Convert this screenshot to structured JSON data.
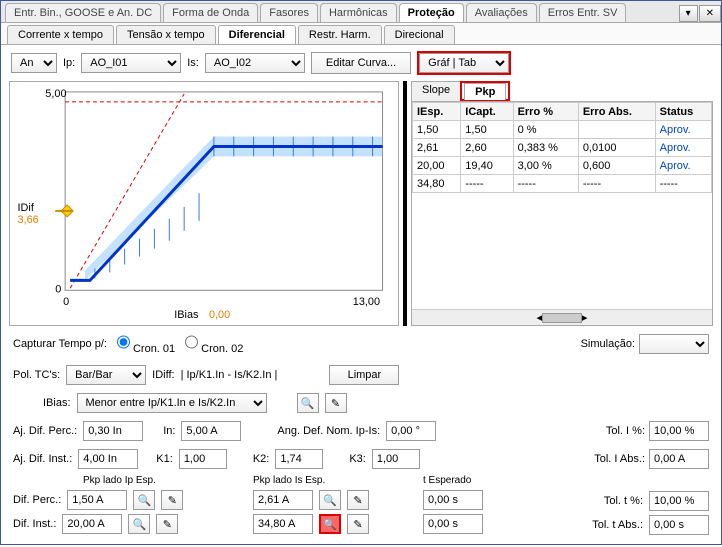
{
  "top_tabs": [
    "Entr. Bin., GOOSE e An. DC",
    "Forma de Onda",
    "Fasores",
    "Harmônicas",
    "Proteção",
    "Avaliações",
    "Erros Entr. SV"
  ],
  "top_active": 4,
  "sub_tabs": [
    "Corrente x tempo",
    "Tensão x tempo",
    "Diferencial",
    "Restr. Harm.",
    "Direcional"
  ],
  "sub_active": 2,
  "toolbar": {
    "an_label": "An",
    "an_value": "",
    "ip_label": "Ip:",
    "ip_value": "AO_I01",
    "is_label": "Is:",
    "is_value": "AO_I02",
    "edit_curve": "Editar Curva...",
    "graf_tab": "Gráf | Tab"
  },
  "chart_data": {
    "type": "line",
    "xlabel": "IBias",
    "xvalue": "0,00",
    "ylabel": "IDif",
    "yvalue": "3,66",
    "xlim": [
      0,
      13
    ],
    "ylim": [
      0,
      5
    ],
    "xticks": [
      0,
      13.0
    ],
    "yticks": [
      0,
      5.0
    ],
    "series": [
      {
        "name": "dashed-red",
        "values": [
          [
            0,
            0
          ],
          [
            4.6,
            5.0
          ]
        ],
        "style": "red-dashed"
      },
      {
        "name": "ref-line",
        "values": [
          [
            0,
            5.0
          ],
          [
            13,
            5.0
          ]
        ],
        "style": "red-dashed-h"
      },
      {
        "name": "curve",
        "values": [
          [
            0,
            0.3
          ],
          [
            1.0,
            0.3
          ],
          [
            6.0,
            3.66
          ],
          [
            13,
            3.66
          ]
        ],
        "style": "blue-thick"
      }
    ],
    "shaded": [
      [
        1.0,
        0.1,
        0.5
      ],
      [
        6.0,
        3.4,
        3.9
      ],
      [
        13,
        3.4,
        3.9
      ]
    ]
  },
  "right_tabs": {
    "slope": "Slope",
    "pkp": "Pkp"
  },
  "table": {
    "cols": [
      "IEsp.",
      "ICapt.",
      "Erro %",
      "Erro Abs.",
      "Status"
    ],
    "rows": [
      [
        "1,50",
        "1,50",
        "0 %",
        "",
        "Aprov."
      ],
      [
        "2,61",
        "2,60",
        "0,383 %",
        "0,0100",
        "Aprov."
      ],
      [
        "20,00",
        "19,40",
        "3,00 %",
        "0,600",
        "Aprov."
      ],
      [
        "34,80",
        "-----",
        "-----",
        "-----",
        "-----"
      ]
    ]
  },
  "capture": {
    "label": "Capturar Tempo p/:",
    "opt1": "Cron. 01",
    "opt2": "Cron. 02"
  },
  "sim_label": "Simulação:",
  "pol_tc": {
    "label": "Pol. TC's:",
    "value": "Bar/Bar",
    "idiff_label": "IDiff:",
    "idiff_formula": "| Ip/K1.In - Is/K2.In |"
  },
  "ibias": {
    "label": "IBias:",
    "value": "Menor entre Ip/K1.In e Is/K2.In"
  },
  "limpar": "Limpar",
  "adjpercdif": {
    "label": "Aj. Dif. Perc.:",
    "value": "0,30 In"
  },
  "adjinstdif": {
    "label": "Aj. Dif. Inst.:",
    "value": "4,00 In"
  },
  "in": {
    "label": "In:",
    "value": "5,00 A"
  },
  "k1": {
    "label": "K1:",
    "value": "1,00"
  },
  "k2": {
    "label": "K2:",
    "value": "1,74"
  },
  "k3": {
    "label": "K3:",
    "value": "1,00"
  },
  "ang": {
    "label": "Ang. Def. Nom. Ip-Is:",
    "value": "0,00 °"
  },
  "tol_i_pct": {
    "label": "Tol. I %:",
    "value": "10,00 %"
  },
  "tol_i_abs": {
    "label": "Tol. I Abs.:",
    "value": "0,00 A"
  },
  "pkp_ip": {
    "legend": "Pkp lado Ip Esp.",
    "perc_label": "Dif. Perc.:",
    "perc_val": "1,50 A",
    "inst_label": "Dif. Inst.:",
    "inst_val": "20,00 A"
  },
  "pkp_is": {
    "legend": "Pkp lado Is Esp.",
    "perc_val": "2,61 A",
    "inst_val": "34,80 A"
  },
  "t_esp": {
    "legend": "t Esperado",
    "v1": "0,00 s",
    "v2": "0,00 s"
  },
  "tol_t_pct": {
    "label": "Tol. t %:",
    "value": "10,00 %"
  },
  "tol_t_abs": {
    "label": "Tol. t Abs.:",
    "value": "0,00 s"
  }
}
